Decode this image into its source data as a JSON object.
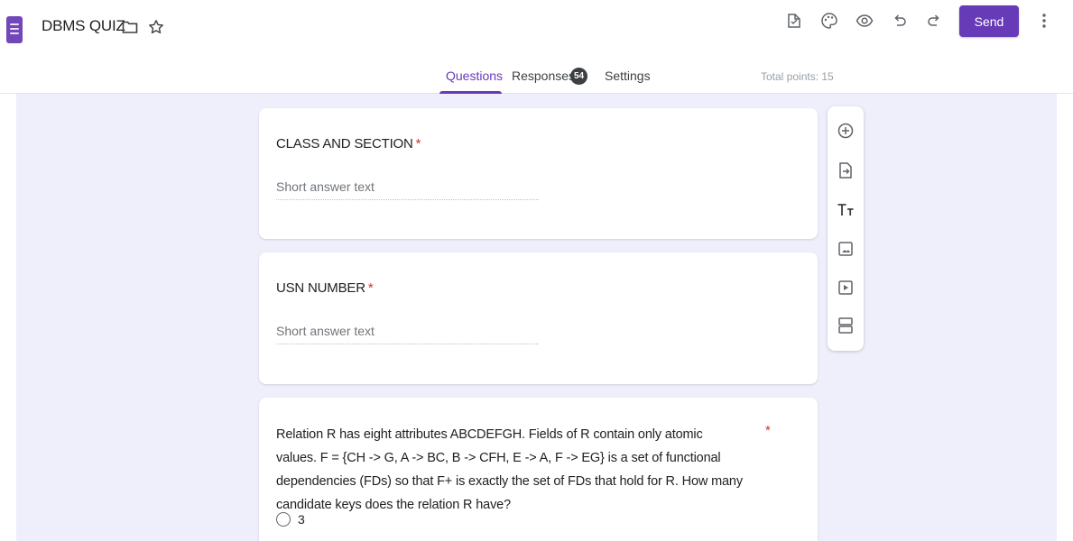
{
  "header": {
    "title": "DBMS QUIZ",
    "send_label": "Send",
    "icons": [
      "folder-icon",
      "star-icon",
      "customize-theme-icon",
      "palette-icon",
      "preview-icon",
      "undo-icon",
      "redo-icon",
      "more-icon"
    ]
  },
  "tabs": {
    "questions": "Questions",
    "responses": "Responses",
    "responses_count": "54",
    "settings": "Settings",
    "total_points": "Total points: 15"
  },
  "questions": [
    {
      "title": "CLASS AND SECTION",
      "required": "*",
      "placeholder": "Short answer text"
    },
    {
      "title": "USN NUMBER",
      "required": "*",
      "placeholder": "Short answer text"
    },
    {
      "text": "Relation R has eight attributes ABCDEFGH. Fields of R contain only atomic values. F = {CH -> G, A -> BC, B -> CFH, E -> A, F -> EG} is a set of functional dependencies (FDs) so that F+ is exactly the set of FDs that hold for R. How many candidate keys does the relation R have?",
      "required": "*",
      "options": [
        "3"
      ]
    }
  ],
  "toolbar": [
    "add-question-icon",
    "import-questions-icon",
    "add-title-icon",
    "add-image-icon",
    "add-video-icon",
    "add-section-icon"
  ],
  "colors": {
    "accent": "#673ab7",
    "canvas": "#efeefb",
    "required": "#d93025"
  }
}
